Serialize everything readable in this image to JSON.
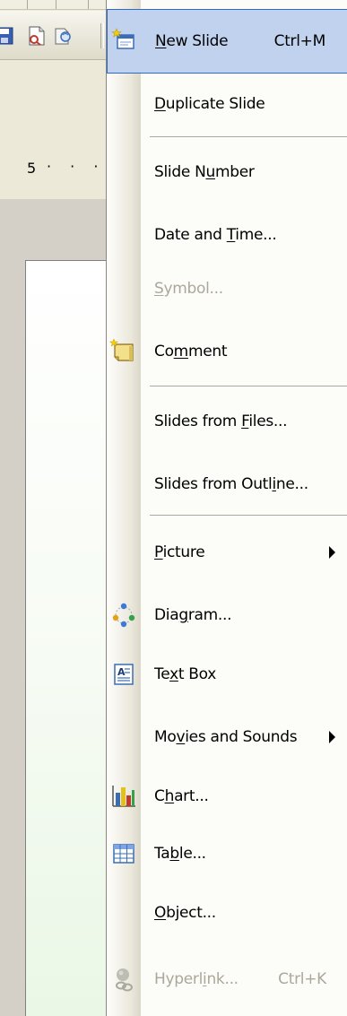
{
  "menu": {
    "items": [
      {
        "id": "new-slide",
        "pre": "",
        "mn": "N",
        "post": "ew Slide",
        "shortcut": "Ctrl+M",
        "icon": "new-slide-icon",
        "disabled": false,
        "highlighted": true,
        "submenu": false
      },
      {
        "id": "duplicate-slide",
        "pre": "",
        "mn": "D",
        "post": "uplicate Slide",
        "shortcut": "",
        "icon": "",
        "disabled": false,
        "highlighted": false,
        "submenu": false
      },
      {
        "id": "slide-number",
        "pre": "Slide N",
        "mn": "u",
        "post": "mber",
        "shortcut": "",
        "icon": "",
        "disabled": false,
        "highlighted": false,
        "submenu": false
      },
      {
        "id": "date-and-time",
        "pre": "Date and ",
        "mn": "T",
        "post": "ime...",
        "shortcut": "",
        "icon": "",
        "disabled": false,
        "highlighted": false,
        "submenu": false
      },
      {
        "id": "symbol",
        "pre": "",
        "mn": "S",
        "post": "ymbol...",
        "shortcut": "",
        "icon": "",
        "disabled": true,
        "highlighted": false,
        "submenu": false
      },
      {
        "id": "comment",
        "pre": "Co",
        "mn": "m",
        "post": "ment",
        "shortcut": "",
        "icon": "comment-icon",
        "disabled": false,
        "highlighted": false,
        "submenu": false
      },
      {
        "id": "slides-from-files",
        "pre": "Slides from ",
        "mn": "F",
        "post": "iles...",
        "shortcut": "",
        "icon": "",
        "disabled": false,
        "highlighted": false,
        "submenu": false
      },
      {
        "id": "slides-from-outline",
        "pre": "Slides from Outl",
        "mn": "i",
        "post": "ne...",
        "shortcut": "",
        "icon": "",
        "disabled": false,
        "highlighted": false,
        "submenu": false
      },
      {
        "id": "picture",
        "pre": "",
        "mn": "P",
        "post": "icture",
        "shortcut": "",
        "icon": "",
        "disabled": false,
        "highlighted": false,
        "submenu": true
      },
      {
        "id": "diagram",
        "pre": "Dia",
        "mn": "g",
        "post": "ram...",
        "shortcut": "",
        "icon": "diagram-icon",
        "disabled": false,
        "highlighted": false,
        "submenu": false
      },
      {
        "id": "text-box",
        "pre": "Te",
        "mn": "x",
        "post": "t Box",
        "shortcut": "",
        "icon": "text-box-icon",
        "disabled": false,
        "highlighted": false,
        "submenu": false
      },
      {
        "id": "movies-and-sounds",
        "pre": "Mo",
        "mn": "v",
        "post": "ies and Sounds",
        "shortcut": "",
        "icon": "",
        "disabled": false,
        "highlighted": false,
        "submenu": true
      },
      {
        "id": "chart",
        "pre": "C",
        "mn": "h",
        "post": "art...",
        "shortcut": "",
        "icon": "chart-icon",
        "disabled": false,
        "highlighted": false,
        "submenu": false
      },
      {
        "id": "table",
        "pre": "Ta",
        "mn": "b",
        "post": "le...",
        "shortcut": "",
        "icon": "table-icon",
        "disabled": false,
        "highlighted": false,
        "submenu": false
      },
      {
        "id": "object",
        "pre": "",
        "mn": "O",
        "post": "bject...",
        "shortcut": "",
        "icon": "",
        "disabled": false,
        "highlighted": false,
        "submenu": false
      },
      {
        "id": "hyperlink",
        "pre": "Hyperl",
        "mn": "i",
        "post": "nk...",
        "shortcut": "Ctrl+K",
        "icon": "hyperlink-icon",
        "disabled": true,
        "highlighted": false,
        "submenu": false
      }
    ]
  },
  "background": {
    "ruler_digit": "5",
    "ruler_dots": "· · ·"
  },
  "colors": {
    "highlight_fill": "#c1d2ee",
    "highlight_border": "#316ac5",
    "disabled_text": "#aca899",
    "menu_background": "#fcfcf9"
  }
}
